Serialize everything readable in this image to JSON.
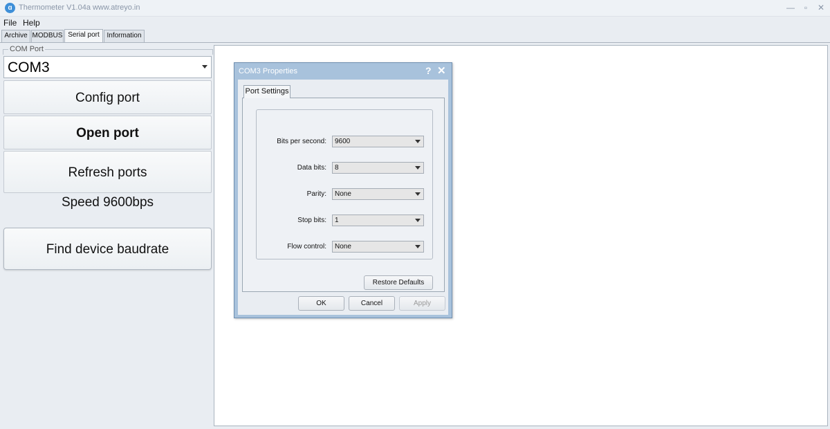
{
  "window": {
    "title": "Thermometer V1.04a www.atreyo.in",
    "icon": "app-logo-icon",
    "minimize_glyph": "—",
    "maximize_glyph": "▫",
    "close_glyph": "✕"
  },
  "menu": {
    "file": "File",
    "help": "Help"
  },
  "tabs": {
    "archive": "Archive",
    "modbus": "MODBUS",
    "serial_port": "Serial port",
    "information": "Information",
    "active": "Serial port"
  },
  "left_panel": {
    "group_label": "COM Port",
    "port_value": "COM3",
    "config_button": "Config port",
    "open_button": "Open port",
    "refresh_button": "Refresh ports",
    "speed_text": "Speed 9600bps",
    "find_baud_button": "Find device baudrate"
  },
  "dialog": {
    "title": "COM3 Properties",
    "help_glyph": "?",
    "close_glyph": "✕",
    "tab": "Port Settings",
    "fields": [
      {
        "label": "Bits per second:",
        "value": "9600"
      },
      {
        "label": "Data bits:",
        "value": "8"
      },
      {
        "label": "Parity:",
        "value": "None"
      },
      {
        "label": "Stop bits:",
        "value": "1"
      },
      {
        "label": "Flow control:",
        "value": "None"
      }
    ],
    "restore_defaults": "Restore Defaults",
    "ok": "OK",
    "cancel": "Cancel",
    "apply": "Apply"
  },
  "colors": {
    "dialog_frame": "#a8c2dc",
    "window_bg": "#e9edf2",
    "app_icon": "#3e8fd8"
  }
}
